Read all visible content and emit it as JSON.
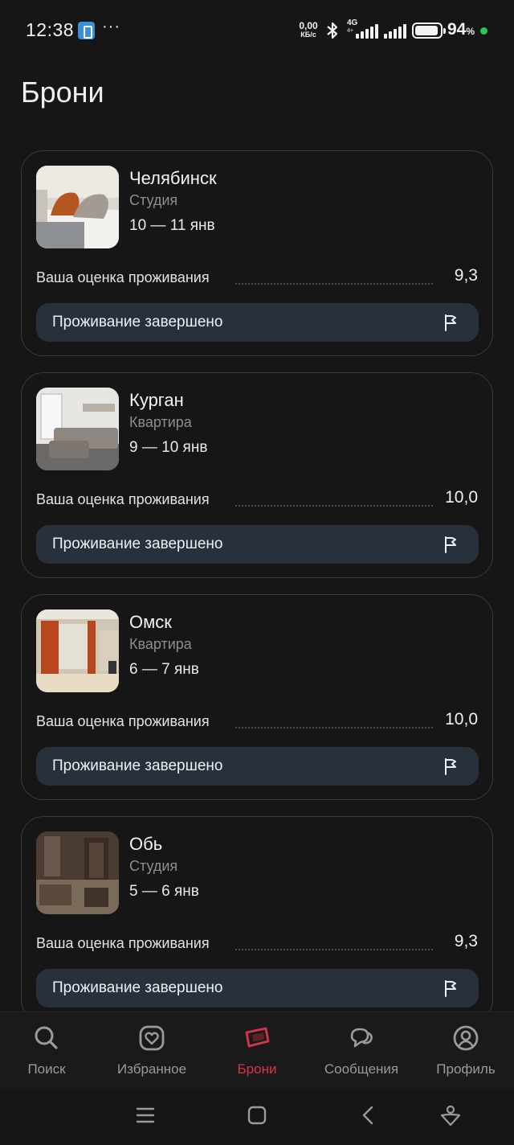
{
  "status_bar": {
    "time": "12:38",
    "dots": "···",
    "speed_value": "0,00",
    "speed_unit": "КБ/с",
    "network": "4G",
    "network_sub": "4+",
    "battery_pct": "94",
    "battery_unit": "%",
    "battery_level": 0.94,
    "dot_color": "#2ec45a"
  },
  "page": {
    "title": "Брони"
  },
  "bookings": [
    {
      "city": "Челябинск",
      "type": "Студия",
      "dates": "10 — 11 янв",
      "rating_label": "Ваша оценка проживания",
      "rating": "9,3",
      "status": "Проживание завершено",
      "status_icon": "flag-icon"
    },
    {
      "city": "Курган",
      "type": "Квартира",
      "dates": "9 — 10 янв",
      "rating_label": "Ваша оценка проживания",
      "rating": "10,0",
      "status": "Проживание завершено",
      "status_icon": "flag-icon"
    },
    {
      "city": "Омск",
      "type": "Квартира",
      "dates": "6 — 7 янв",
      "rating_label": "Ваша оценка проживания",
      "rating": "10,0",
      "status": "Проживание завершено",
      "status_icon": "flag-icon"
    },
    {
      "city": "Обь",
      "type": "Студия",
      "dates": "5 — 6 янв",
      "rating_label": "Ваша оценка проживания",
      "rating": "9,3",
      "status": "Проживание завершено",
      "status_icon": "flag-icon"
    }
  ],
  "bottom_nav": {
    "items": [
      {
        "label": "Поиск",
        "icon": "search-icon",
        "active": false
      },
      {
        "label": "Избранное",
        "icon": "heart-icon",
        "active": false
      },
      {
        "label": "Брони",
        "icon": "ticket-icon",
        "active": true
      },
      {
        "label": "Сообщения",
        "icon": "chat-icon",
        "active": false
      },
      {
        "label": "Профиль",
        "icon": "profile-icon",
        "active": false
      }
    ],
    "active_color": "#d8344a",
    "inactive_color": "#9a9a9a"
  },
  "system_nav": {
    "icons": [
      "menu-icon",
      "home-icon",
      "back-icon",
      "assistant-icon"
    ]
  },
  "colors": {
    "background": "#161616",
    "card_border": "#3a3a3a",
    "status_button": "#28303c",
    "accent": "#d8344a"
  }
}
